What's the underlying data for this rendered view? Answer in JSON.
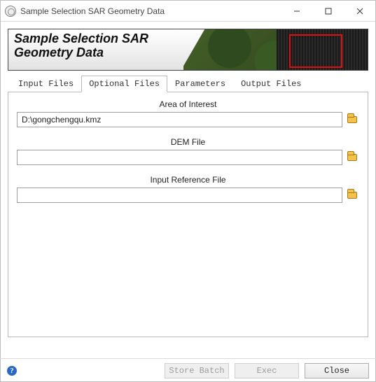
{
  "window": {
    "title": "Sample Selection SAR Geometry Data"
  },
  "banner": {
    "title": "Sample Selection SAR\nGeometry Data"
  },
  "tabs": [
    {
      "label": "Input Files",
      "active": false
    },
    {
      "label": "Optional Files",
      "active": true
    },
    {
      "label": "Parameters",
      "active": false
    },
    {
      "label": "Output Files",
      "active": false
    }
  ],
  "fields": {
    "aoi": {
      "label": "Area of Interest",
      "value": "D:\\gongchengqu.kmz"
    },
    "dem": {
      "label": "DEM File",
      "value": ""
    },
    "ref": {
      "label": "Input Reference File",
      "value": ""
    }
  },
  "footer": {
    "help_glyph": "?",
    "store_batch": "Store Batch",
    "exec": "Exec",
    "close": "Close"
  }
}
